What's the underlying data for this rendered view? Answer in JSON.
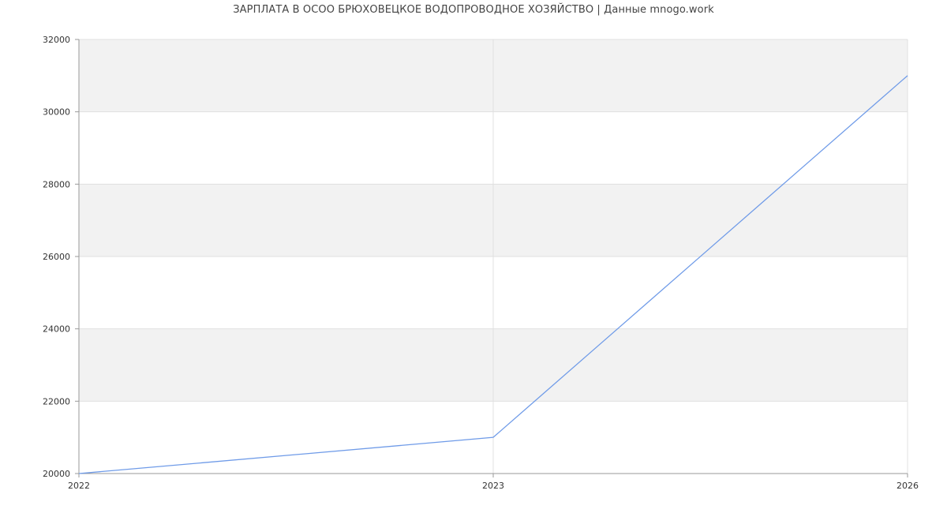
{
  "page": {
    "title": "ЗАРПЛАТА В ОСОО БРЮХОВЕЦКОЕ ВОДОПРОВОДНОЕ ХОЗЯЙСТВО | Данные mnogo.work"
  },
  "chart_data": {
    "type": "line",
    "title": "ЗАРПЛАТА В ОСОО БРЮХОВЕЦКОЕ ВОДОПРОВОДНОЕ ХОЗЯЙСТВО | Данные mnogo.work",
    "xlabel": "",
    "ylabel": "",
    "x": [
      "2022",
      "2023",
      "2026"
    ],
    "series": [
      {
        "values": [
          20000,
          21000,
          31000
        ]
      }
    ],
    "ylim": [
      20000,
      32000
    ],
    "y_ticks": [
      "20000",
      "22000",
      "24000",
      "26000",
      "28000",
      "30000",
      "32000"
    ],
    "x_ticks": [
      "2022",
      "2023",
      "2026"
    ],
    "grid": true,
    "legend": "none",
    "colors": {
      "line": "#6f9be8",
      "band": "#f2f2f2",
      "grid": "#e0e0e0",
      "axis": "#999999"
    }
  }
}
